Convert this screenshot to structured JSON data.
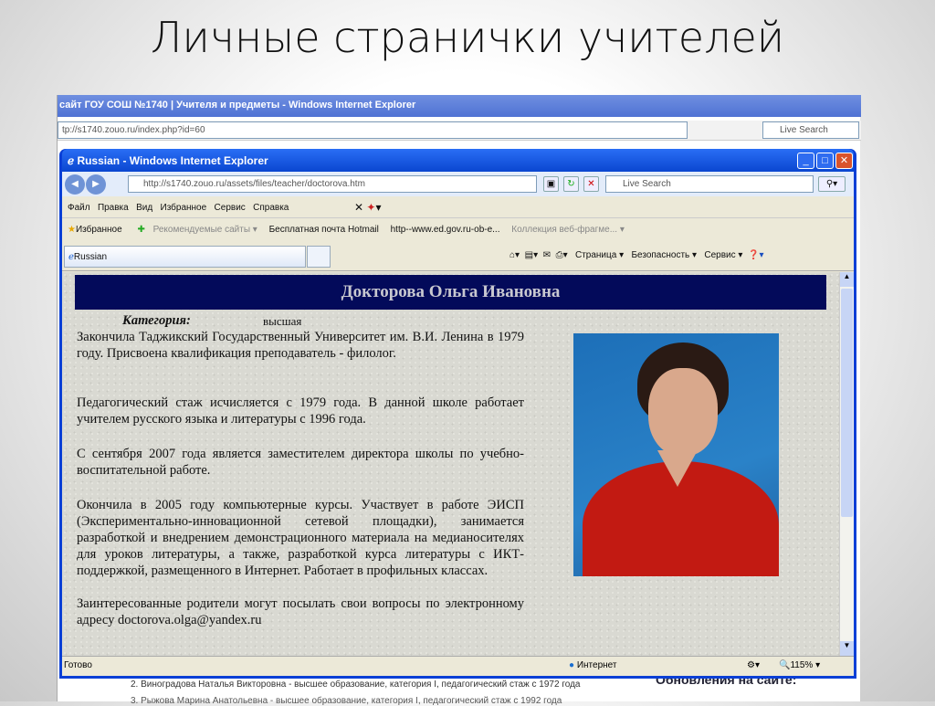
{
  "slide_title": "Личные странички учителей",
  "background_window": {
    "title": "сайт ГОУ СОШ №1740 | Учителя и предметы - Windows Internet Explorer",
    "address": "tp://s1740.zouo.ru/index.php?id=60",
    "search_placeholder": "Live Search",
    "list": [
      "2. Виноградова Наталья Викторовна - высшее образование, категория I, педагогический стаж с 1972 года",
      "3. Рыжова Марина Анатольевна - высшее образование, категория I, педагогический стаж с 1992 года"
    ],
    "side_heading": "Обновления на сайте:"
  },
  "window": {
    "title": "Russian - Windows Internet Explorer",
    "address": "http://s1740.zouo.ru/assets/files/teacher/doctorova.htm",
    "search_placeholder": "Live Search",
    "menu": [
      "Файл",
      "Правка",
      "Вид",
      "Избранное",
      "Сервис",
      "Справка"
    ],
    "favorites": {
      "label": "Избранное",
      "items": [
        "Рекомендуемые сайты ▾",
        "Бесплатная почта Hotmail",
        "http--www.ed.gov.ru-ob-e...",
        "Коллекция веб-фрагме... ▾"
      ]
    },
    "tab": "Russian",
    "commands": [
      "Страница ▾",
      "Безопасность ▾",
      "Сервис ▾"
    ],
    "status": {
      "text": "Готово",
      "zone": "Интернет",
      "zoom": "115%"
    }
  },
  "page": {
    "name": "Докторова Ольга Ивановна",
    "category_label": "Категория:",
    "category_value": "высшая",
    "paragraphs": [
      "Закончила Таджикский Государственный Университет им. В.И. Ленина в 1979 году. Присвоена квалификация преподаватель - филолог.",
      "Педагогический стаж исчисляется с 1979 года. В данной школе работает учителем русского языка и литературы с 1996 года.",
      "С сентября 2007 года является заместителем директора школы по учебно-воспитательной работе.",
      "Окончила в 2005 году компьютерные курсы. Участвует в работе ЭИСП (Экспериментально-инновационной сетевой площадки), занимается разработкой и внедрением демонстрационного материала на медианосителях для уроков литературы, а также, разработкой курса литературы с ИКТ-поддержкой, размещенного в Интернет. Работает в профильных классах.",
      "Заинтересованные родители могут посылать свои вопросы по электронному адресу doctorova.olga@yandex.ru"
    ]
  }
}
